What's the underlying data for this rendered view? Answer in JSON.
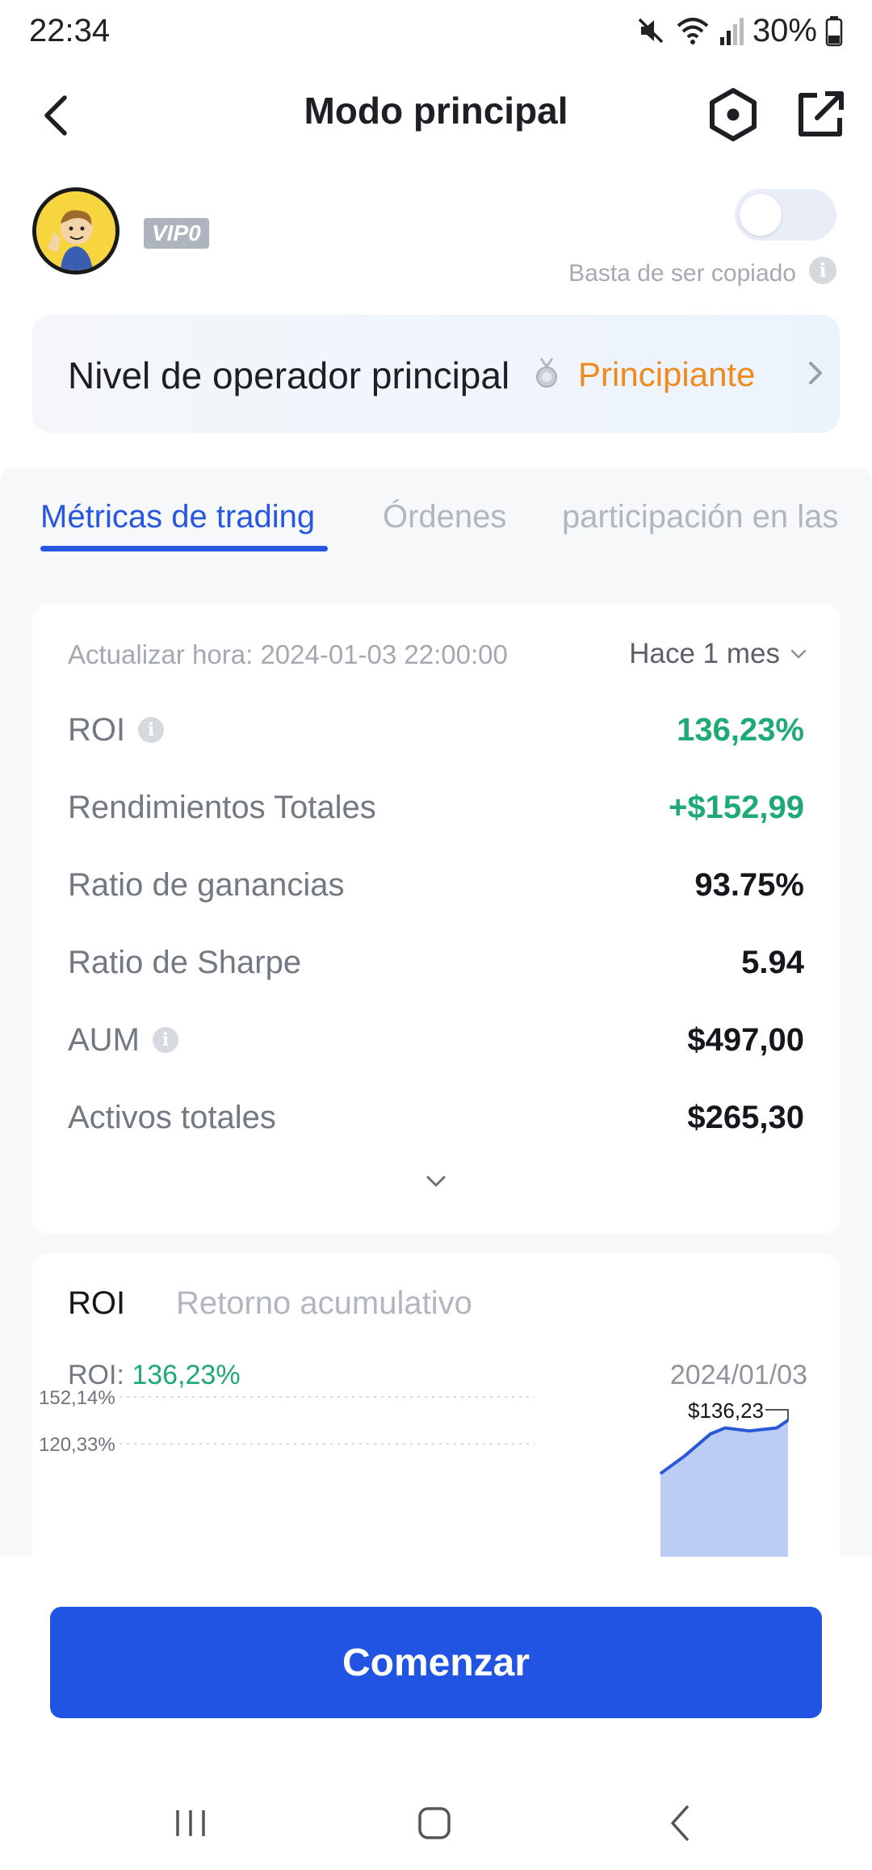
{
  "status": {
    "time": "22:34",
    "battery": "30%"
  },
  "header": {
    "title": "Modo principal"
  },
  "profile": {
    "vip": "VIP0",
    "toggle_caption": "Basta de ser copiado",
    "toggle_on": false
  },
  "level": {
    "label": "Nivel de operador principal",
    "value": "Principiante"
  },
  "tabs": [
    {
      "label": "Métricas de trading",
      "active": true
    },
    {
      "label": "Órdenes",
      "active": false
    },
    {
      "label": "participación en las",
      "active": false
    }
  ],
  "metrics": {
    "update_time": "Actualizar hora: 2024-01-03 22:00:00",
    "period": "Hace 1 mes",
    "rows": [
      {
        "label": "ROI",
        "value": "136,23%",
        "info": true
      },
      {
        "label": "Rendimientos Totales",
        "value": "+$152,99"
      },
      {
        "label": "Ratio de ganancias",
        "value": "93.75%"
      },
      {
        "label": "Ratio de Sharpe",
        "value": "5.94"
      },
      {
        "label": "AUM",
        "value": "$497,00",
        "info": true
      },
      {
        "label": "Activos totales",
        "value": "$265,30"
      }
    ]
  },
  "chart": {
    "tabs": [
      "ROI",
      "Retorno acumulativo"
    ],
    "roi_label": "ROI: ",
    "roi_value": "136,23%",
    "date": "2024/01/03",
    "tooltip": "$136,23"
  },
  "chart_data": {
    "type": "area",
    "y_ticks": [
      "152,14%",
      "120,33%"
    ],
    "y_tick_values": [
      152.14,
      120.33
    ],
    "series": [
      {
        "values": [
          100,
          112,
          127,
          131,
          129,
          131,
          136.23
        ]
      }
    ]
  },
  "colors": {
    "accent": "#2756e0",
    "button": "#2254e3",
    "positive": "#1eaa74",
    "level": "#ef8a1f"
  },
  "cta": {
    "label": "Comenzar"
  }
}
